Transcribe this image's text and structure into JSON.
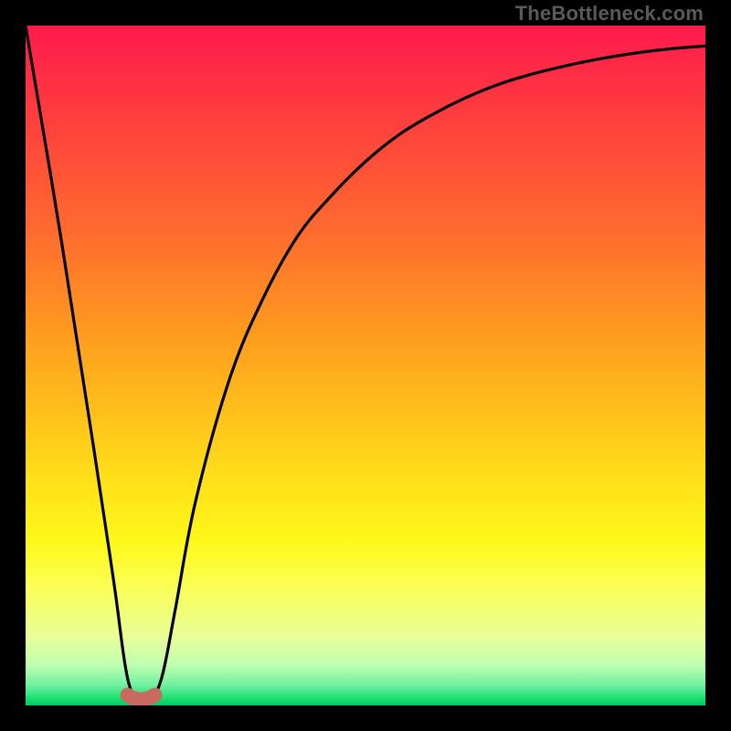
{
  "watermark": {
    "text": "TheBottleneck.com"
  },
  "colors": {
    "gradient_top": "#ff1a4d",
    "gradient_bottom": "#00c860",
    "curve": "#000000",
    "marker": "#c96a60",
    "frame": "#000000"
  },
  "chart_data": {
    "type": "line",
    "title": "",
    "xlabel": "",
    "ylabel": "",
    "xlim": [
      0,
      100
    ],
    "ylim": [
      0,
      100
    ],
    "grid": false,
    "legend": false,
    "series": [
      {
        "name": "bottleneck-curve",
        "x": [
          0,
          5,
          10,
          13,
          15,
          17,
          18,
          20,
          22,
          25,
          30,
          35,
          40,
          45,
          50,
          55,
          60,
          65,
          70,
          75,
          80,
          85,
          90,
          95,
          100
        ],
        "values": [
          100,
          70,
          38,
          18,
          4,
          0,
          0,
          4,
          14,
          30,
          48,
          60,
          69,
          75,
          80,
          84,
          87,
          89.5,
          91.5,
          93,
          94.2,
          95.2,
          96,
          96.6,
          97
        ]
      }
    ],
    "marker": {
      "name": "minimum-indicator",
      "x_range": [
        15,
        19
      ],
      "y": 1,
      "径": 8
    },
    "annotations": []
  }
}
